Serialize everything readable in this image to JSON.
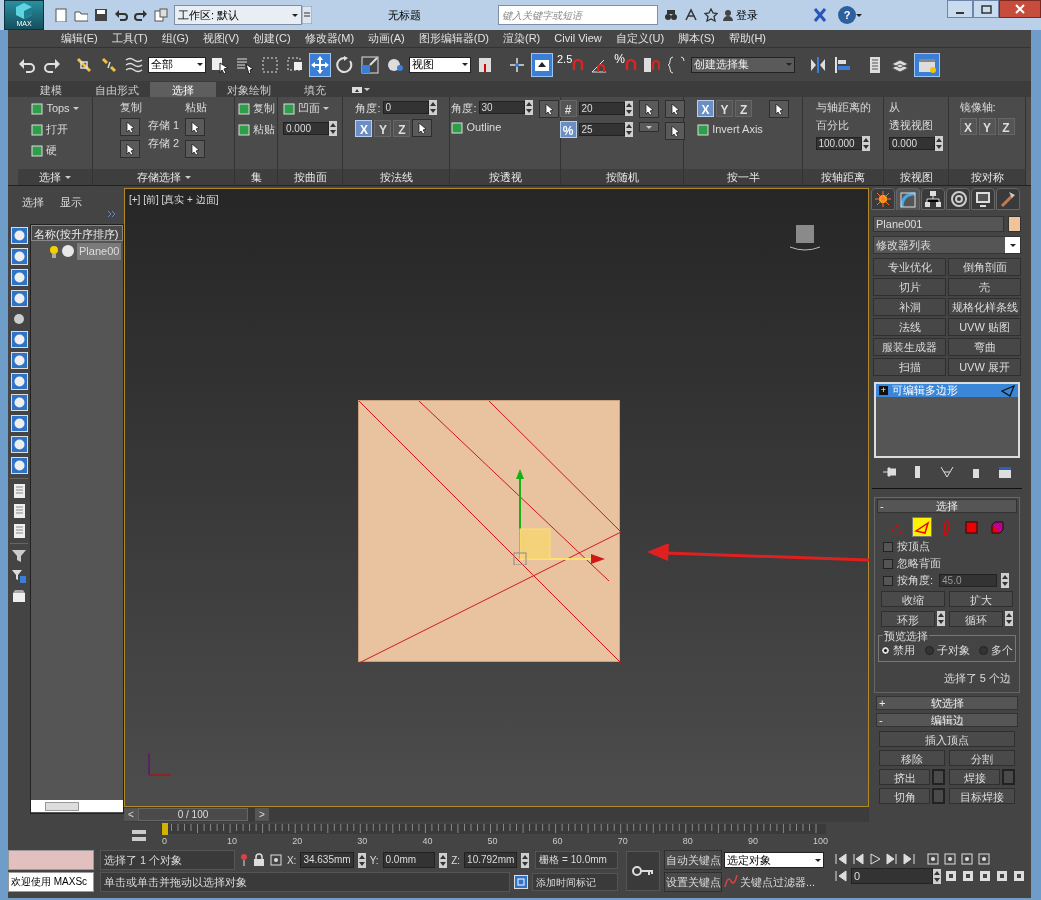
{
  "app": {
    "logo": "MAX",
    "workspace": "工作区: 默认",
    "title": "无标题",
    "search_placeholder": "键入关键字或短语",
    "login": "登录",
    "help": "?"
  },
  "menu": [
    "编辑(E)",
    "工具(T)",
    "组(G)",
    "视图(V)",
    "创建(C)",
    "修改器(M)",
    "动画(A)",
    "图形编辑器(D)",
    "渲染(R)",
    "Civil View",
    "自定义(U)",
    "脚本(S)",
    "帮助(H)"
  ],
  "toolbar": {
    "filter": "全部",
    "coord": "视图",
    "snap_angle": "2.5",
    "snap_percent": "%",
    "named_set": "创建选择集",
    "move_selected": true,
    "keyboard_selected": true,
    "explorer_selected": true
  },
  "ribbon_tabs": [
    {
      "label": "建模",
      "selected": false
    },
    {
      "label": "自由形式",
      "selected": false
    },
    {
      "label": "选择",
      "selected": true
    },
    {
      "label": "对象绘制",
      "selected": false
    },
    {
      "label": "填充",
      "selected": false
    }
  ],
  "ribbon_groups": [
    {
      "label": "选择",
      "caret": true,
      "cols": [
        [
          {
            "kind": "icon-text",
            "text": "Tops",
            "caret": true
          },
          {
            "kind": "icon-text",
            "text": "打开"
          },
          {
            "kind": "icon-text",
            "text": "硬"
          }
        ]
      ]
    },
    {
      "label": "存储选择",
      "caret": true,
      "cols": [
        [
          {
            "kind": "text",
            "text": "复制"
          },
          {
            "kind": "icon-button"
          },
          {
            "kind": "icon-button"
          }
        ],
        [
          {
            "kind": "gap"
          },
          {
            "kind": "text",
            "text": "存储 1"
          },
          {
            "kind": "text",
            "text": "存储 2"
          }
        ],
        [
          {
            "kind": "text",
            "text": "粘贴"
          },
          {
            "kind": "icon-button"
          },
          {
            "kind": "icon-button"
          }
        ]
      ]
    },
    {
      "label": "集",
      "caret": false,
      "cols": [
        [
          {
            "kind": "icon-text",
            "text": "复制"
          },
          {
            "kind": "icon-text",
            "text": "粘贴"
          }
        ]
      ]
    },
    {
      "label": "按曲面",
      "caret": false,
      "cols": [
        [
          {
            "kind": "icon-text",
            "text": "凹面",
            "caret": true
          },
          {
            "kind": "spinner",
            "text": "0.000"
          }
        ]
      ]
    },
    {
      "label": "按法线",
      "caret": false,
      "cols": [
        [
          {
            "kind": "row",
            "items": [
              {
                "kind": "text",
                "text": "角度:"
              },
              {
                "kind": "spinner",
                "text": "0"
              }
            ]
          },
          {
            "kind": "row",
            "items": [
              {
                "kind": "axis",
                "text": "X",
                "selected": true
              },
              {
                "kind": "axis",
                "text": "Y",
                "selected": false
              },
              {
                "kind": "axis",
                "text": "Z",
                "selected": false
              },
              {
                "kind": "icon-button"
              }
            ]
          }
        ]
      ]
    },
    {
      "label": "按透视",
      "caret": false,
      "cols": [
        [
          {
            "kind": "row",
            "items": [
              {
                "kind": "text",
                "text": "角度:"
              },
              {
                "kind": "spinner",
                "text": "30"
              }
            ]
          },
          {
            "kind": "icon-text",
            "text": "Outline"
          }
        ],
        [
          {
            "kind": "icon-button"
          }
        ]
      ]
    },
    {
      "label": "按随机",
      "caret": false,
      "cols": [
        [
          {
            "kind": "row",
            "items": [
              {
                "kind": "axis",
                "text": "#",
                "selected": false
              },
              {
                "kind": "spinner",
                "text": "20"
              }
            ]
          },
          {
            "kind": "row",
            "items": [
              {
                "kind": "axis",
                "text": "%",
                "selected": true
              },
              {
                "kind": "spinner",
                "text": "25"
              }
            ]
          }
        ],
        [
          {
            "kind": "icon-button"
          },
          {
            "kind": "caret-button"
          }
        ],
        [
          {
            "kind": "icon-button"
          },
          {
            "kind": "icon-button"
          }
        ]
      ]
    },
    {
      "label": "按一半",
      "caret": false,
      "cols": [
        [
          {
            "kind": "row",
            "items": [
              {
                "kind": "axis",
                "text": "X",
                "selected": true
              },
              {
                "kind": "axis",
                "text": "Y",
                "selected": false
              },
              {
                "kind": "axis",
                "text": "Z",
                "selected": false
              }
            ]
          },
          {
            "kind": "icon-text",
            "text": "Invert Axis"
          }
        ],
        [
          {
            "kind": "icon-button"
          }
        ]
      ]
    },
    {
      "label": "按轴距离",
      "caret": false,
      "cols": [
        [
          {
            "kind": "text",
            "text": "与轴距离的"
          },
          {
            "kind": "text",
            "text": "百分比"
          },
          {
            "kind": "spinner",
            "text": "100.000"
          }
        ]
      ]
    },
    {
      "label": "按视图",
      "caret": false,
      "cols": [
        [
          {
            "kind": "text",
            "text": "从"
          },
          {
            "kind": "text",
            "text": "透视视图"
          },
          {
            "kind": "spinner",
            "text": "0.000"
          }
        ]
      ]
    },
    {
      "label": "按对称",
      "caret": false,
      "cols": [
        [
          {
            "kind": "text",
            "text": "镜像轴:"
          },
          {
            "kind": "row",
            "items": [
              {
                "kind": "axis",
                "text": "X",
                "selected": false
              },
              {
                "kind": "axis",
                "text": "Y",
                "selected": false
              },
              {
                "kind": "axis",
                "text": "Z",
                "selected": false
              }
            ]
          }
        ]
      ]
    }
  ],
  "explorer": {
    "tabs": [
      "选择",
      "显示"
    ],
    "column": "名称(按升序排序)",
    "items": [
      {
        "label": "Plane00",
        "selected": true
      }
    ]
  },
  "viewport": {
    "label": "[+] [前] [真实 + 边面]",
    "time": "0 / 100",
    "prev": "<",
    "next": ">"
  },
  "timeline": {
    "ticks": [
      "0",
      "10",
      "20",
      "30",
      "40",
      "50",
      "60",
      "70",
      "80",
      "90",
      "100"
    ]
  },
  "command_panel": {
    "tabs": [
      {
        "kind": "create",
        "selected": false
      },
      {
        "kind": "modify",
        "selected": true
      },
      {
        "kind": "hierarchy",
        "selected": false
      },
      {
        "kind": "motion",
        "selected": false
      },
      {
        "kind": "display",
        "selected": false
      },
      {
        "kind": "utilities",
        "selected": false
      }
    ],
    "object_name": "Plane001",
    "modifier_list": "修改器列表",
    "modifier_buttons": [
      "专业优化",
      "倒角剖面",
      "切片",
      "壳",
      "补洞",
      "规格化样条线",
      "法线",
      "UVW 贴图",
      "服装生成器",
      "弯曲",
      "扫描",
      "UVW 展开"
    ],
    "stack": [
      {
        "label": "可编辑多边形",
        "toggle": "+",
        "selected": true
      }
    ],
    "selection": {
      "toggle": "-",
      "title": "选择",
      "levels": [
        {
          "kind": "vertex",
          "selected": false
        },
        {
          "kind": "edge",
          "selected": true
        },
        {
          "kind": "border",
          "selected": false
        },
        {
          "kind": "polygon",
          "selected": false
        },
        {
          "kind": "element",
          "selected": false
        }
      ],
      "checks": [
        {
          "label": "按顶点",
          "checked": false
        },
        {
          "label": "忽略背面",
          "checked": false
        },
        {
          "label": "按角度:",
          "checked": false,
          "value": "45.0"
        }
      ],
      "shrink": "收缩",
      "grow": "扩大",
      "ring": "环形",
      "loop": "循环",
      "preview_title": "预览选择",
      "preview": [
        {
          "label": "禁用",
          "selected": true
        },
        {
          "label": "子对象",
          "selected": false
        },
        {
          "label": "多个",
          "selected": false
        }
      ],
      "info": "选择了 5 个边"
    },
    "rollouts": [
      {
        "toggle": "+",
        "label": "软选择"
      },
      {
        "toggle": "-",
        "label": "编辑边"
      }
    ],
    "edit_edge_buttons": [
      {
        "label": "插入顶点",
        "wide": true,
        "settings": false
      },
      {
        "label": "移除",
        "wide": false,
        "settings": false
      },
      {
        "label": "分割",
        "wide": false,
        "settings": false
      },
      {
        "label": "挤出",
        "wide": false,
        "settings": true
      },
      {
        "label": "焊接",
        "wide": false,
        "settings": true
      },
      {
        "label": "切角",
        "wide": false,
        "settings": true
      },
      {
        "label": "目标焊接",
        "wide": false,
        "settings": false
      }
    ]
  },
  "status": {
    "welcome": "欢迎使用 MAXSc",
    "selection_info": "选择了 1 个对象",
    "prompt": "单击或单击并拖动以选择对象",
    "x_label": "X:",
    "x": "34.635mm",
    "y_label": "Y:",
    "y": "0.0mm",
    "z_label": "Z:",
    "z": "10.792mm",
    "grid": "栅格 = 10.0mm",
    "add_tag": "添加时间标记",
    "auto_key": "自动关键点",
    "set_key": "设置关键点",
    "key_mode": "选定对象",
    "key_filters": "关键点过滤器...",
    "frame": "0"
  }
}
